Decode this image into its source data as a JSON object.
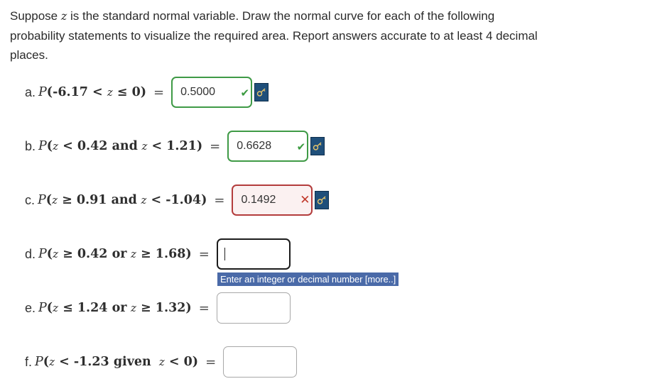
{
  "intro": {
    "line1_a": "Suppose ",
    "var": "z",
    "line1_b": " is the standard normal variable. Draw the normal curve for each of the following probability statements to visualize the required area. Report answers accurate to at least 4 decimal places."
  },
  "questions": [
    {
      "label": "a.",
      "p": "P",
      "lhs": "(-6.17 < ",
      "z": "z",
      "rhs": " ≤ 0)",
      "answer": "0.5000",
      "status": "correct"
    },
    {
      "label": "b.",
      "p": "P",
      "lhs": "(",
      "z": "z",
      "mid": " < 0.42 ",
      "word": "and",
      "z2": "z",
      "rhs": " < 1.21)",
      "answer": "0.6628",
      "status": "correct"
    },
    {
      "label": "c.",
      "p": "P",
      "lhs": "(",
      "z": "z",
      "mid": " ≥ 0.91 ",
      "word": "and",
      "z2": "z",
      "rhs": " < -1.04)",
      "answer": "0.1492",
      "status": "wrong"
    },
    {
      "label": "d.",
      "p": "P",
      "lhs": "(",
      "z": "z",
      "mid": " ≥ 0.42 ",
      "word": "or",
      "z2": "z",
      "rhs": " ≥ 1.68)",
      "answer": "",
      "status": "active"
    },
    {
      "label": "e.",
      "p": "P",
      "lhs": "(",
      "z": "z",
      "mid": " ≤ 1.24 ",
      "word": "or",
      "z2": "z",
      "rhs": " ≥ 1.32)",
      "answer": "",
      "status": "empty"
    },
    {
      "label": "f.",
      "p": "P",
      "lhs": "(",
      "z": "z",
      "mid": " < -1.23 ",
      "word": "given",
      "z2": "z",
      "rhs": " < 0)",
      "answer": "",
      "status": "empty"
    }
  ],
  "equals": "=",
  "marks": {
    "check": "✔",
    "cross": "✕"
  },
  "hint": "Enter an integer or decimal number [more..]",
  "icons": {
    "key": "key-icon",
    "check": "checkmark-icon",
    "cross": "cross-icon"
  },
  "colors": {
    "correct": "#3f9a46",
    "wrong": "#b33c3c",
    "key_button": "#1f4f7a",
    "hint_bg": "#4a6aa8"
  }
}
